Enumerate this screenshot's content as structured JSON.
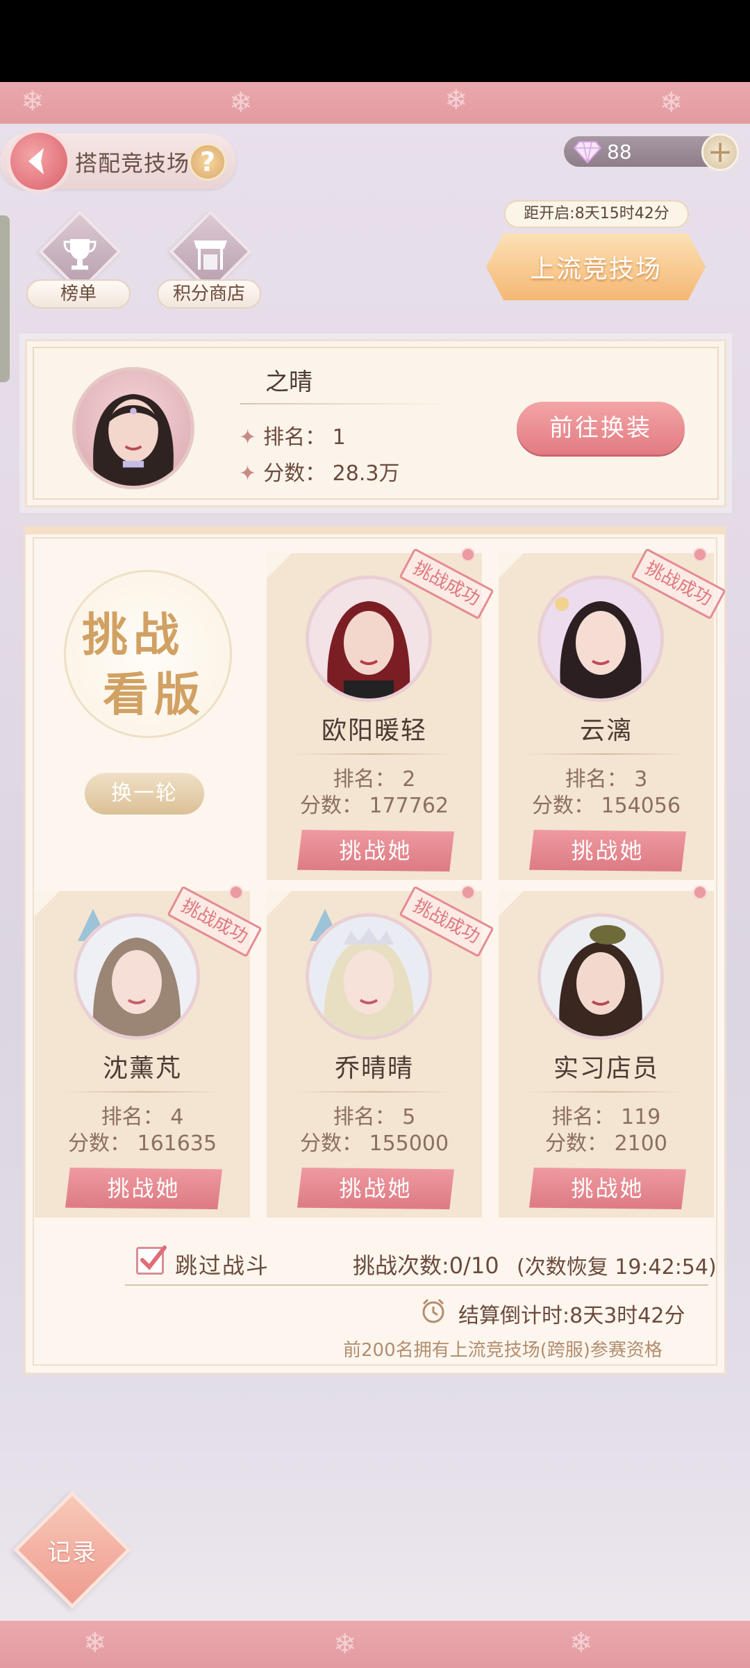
{
  "header": {
    "title": "搭配竞技场",
    "help_icon": "?",
    "gems": "88",
    "plus": "+"
  },
  "widgets": {
    "rank_label": "榜单",
    "shop_label": "积分商店"
  },
  "upper_arena": {
    "countdown": "距开启:8天15时42分",
    "label": "上流竞技场"
  },
  "player": {
    "name": "之晴",
    "rank": "排名： 1",
    "score": "分数： 28.3万",
    "dress_button": "前往换装"
  },
  "board": {
    "badge_line1": "挑战",
    "badge_line2": "看版",
    "refresh_button": "换一轮"
  },
  "opponents": [
    {
      "name": "欧阳暖轻",
      "rank": "排名： 2",
      "score": "分数： 177762",
      "button": "挑战她",
      "stamp": "挑战成功"
    },
    {
      "name": "云漓",
      "rank": "排名： 3",
      "score": "分数： 154056",
      "button": "挑战她",
      "stamp": "挑战成功"
    },
    {
      "name": "沈薰芃",
      "rank": "排名： 4",
      "score": "分数： 161635",
      "button": "挑战她",
      "stamp": "挑战成功"
    },
    {
      "name": "乔晴晴",
      "rank": "排名： 5",
      "score": "分数： 155000",
      "button": "挑战她",
      "stamp": "挑战成功"
    },
    {
      "name": "实习店员",
      "rank": "排名： 119",
      "score": "分数： 2100",
      "button": "挑战她",
      "stamp": ""
    }
  ],
  "footer": {
    "skip_label": "跳过战斗",
    "challenge_count": "挑战次数:0/10",
    "recover_time": "(次数恢复 19:42:54)",
    "settle_countdown": "结算倒计时:8天3时42分",
    "qualification_note": "前200名拥有上流竞技场(跨服)参赛资格"
  },
  "record_label": "记录",
  "colors": {
    "accent_pink": "#e27b82",
    "gold": "#d1a163",
    "panel": "#fcf6ee"
  }
}
